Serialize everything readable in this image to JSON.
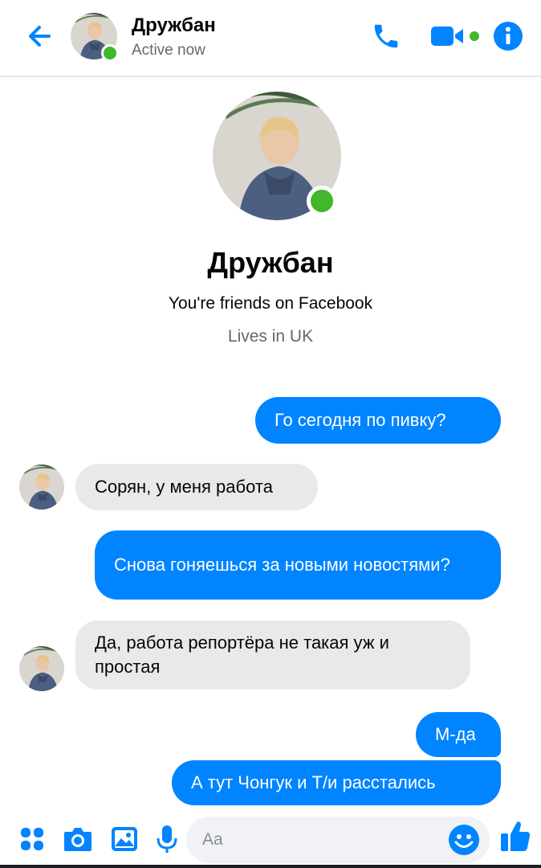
{
  "header": {
    "back_icon": "arrow-left-icon",
    "contact_name": "Дружбан",
    "status": "Active now",
    "call_icon": "phone-icon",
    "video_icon": "video-camera-icon",
    "info_icon": "info-icon"
  },
  "profile": {
    "name": "Дружбан",
    "friends_line": "You're friends on Facebook",
    "lives_line": "Lives in UK"
  },
  "messages": [
    {
      "direction": "out",
      "text": "Го сегодня по пивку?"
    },
    {
      "direction": "in",
      "text": "Сорян, у меня работа"
    },
    {
      "direction": "out",
      "text": "Снова гоняешься за новыми новостями?"
    },
    {
      "direction": "in",
      "text": "Да, работа репортёра не такая уж и простая"
    },
    {
      "direction": "out",
      "text": "М-да"
    },
    {
      "direction": "out",
      "text": "А тут Чонгук и Т/и расстались"
    }
  ],
  "composer": {
    "placeholder": "Aa",
    "icons": [
      "apps-grid-icon",
      "camera-icon",
      "gallery-image-icon",
      "microphone-icon",
      "emoji-icon",
      "thumbs-up-icon"
    ]
  },
  "colors": {
    "accent": "#0084ff",
    "outgoing_bubble": "#0084ff",
    "incoming_bubble": "#e9e9eb",
    "online": "#42b72a"
  }
}
